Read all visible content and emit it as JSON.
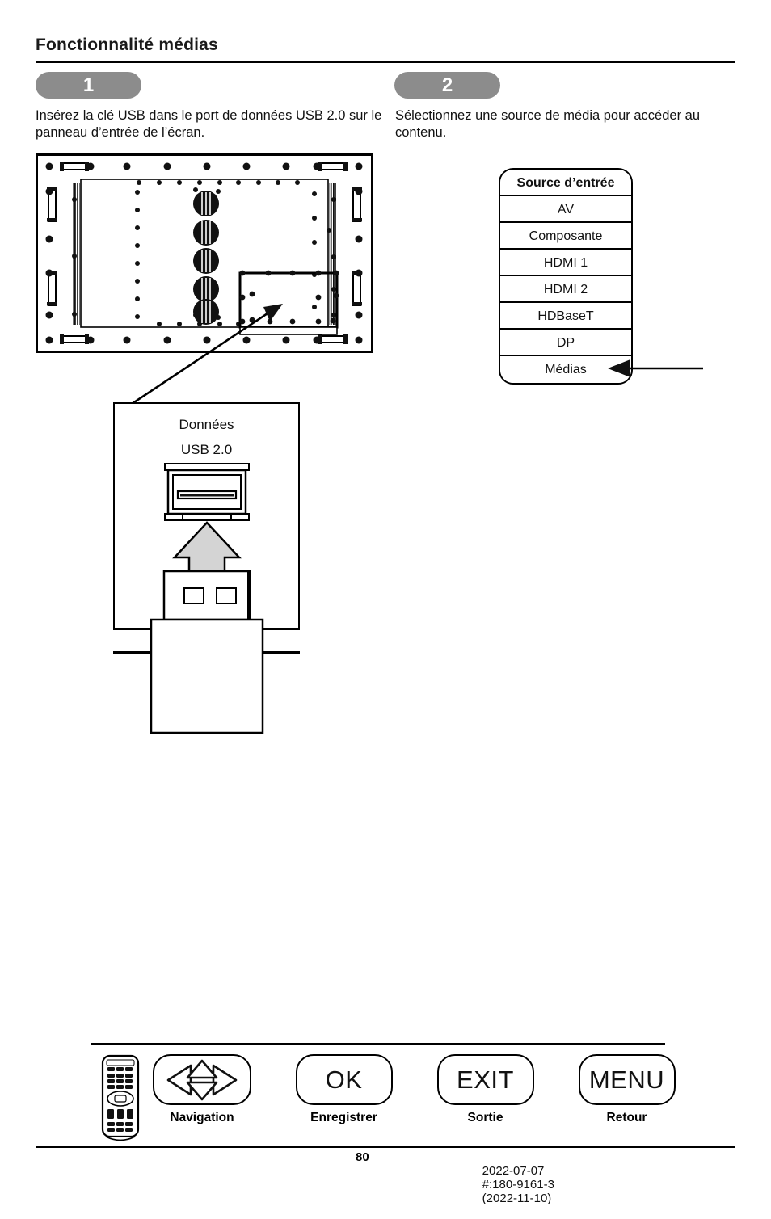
{
  "header": {
    "title": "Fonctionnalité médias"
  },
  "steps": [
    {
      "number": "1",
      "text": "Insérez la clé USB dans le port de données USB 2.0 sur le panneau d’entrée de l’écran."
    },
    {
      "number": "2",
      "text": "Sélectionnez une source de média pour accéder au contenu."
    }
  ],
  "callout": {
    "line1": "Données",
    "line2": "USB 2.0"
  },
  "source_menu": {
    "header": "Source d’entrée",
    "items": [
      "AV",
      "Composante",
      "HDMI 1",
      "HDMI 2",
      "HDBaseT",
      "DP",
      "Médias"
    ],
    "highlighted": "Médias"
  },
  "footer_keys": [
    {
      "icon": "remote-control-icon",
      "label": "",
      "caption": ""
    },
    {
      "icon": "navigation-arrows-icon",
      "label": "",
      "caption": "Navigation"
    },
    {
      "icon": "",
      "label": "OK",
      "caption": "Enregistrer"
    },
    {
      "icon": "",
      "label": "EXIT",
      "caption": "Sortie"
    },
    {
      "icon": "",
      "label": "MENU",
      "caption": "Retour"
    }
  ],
  "page_footer": {
    "page_number": "80",
    "date": "2022-07-07",
    "doc_id": "#:180-9161-3",
    "revision": "(2022-11-10)"
  },
  "colors": {
    "badge_gray": "#8c8c8c",
    "ink": "#000000",
    "arrow_fill": "#d4d4d4"
  }
}
